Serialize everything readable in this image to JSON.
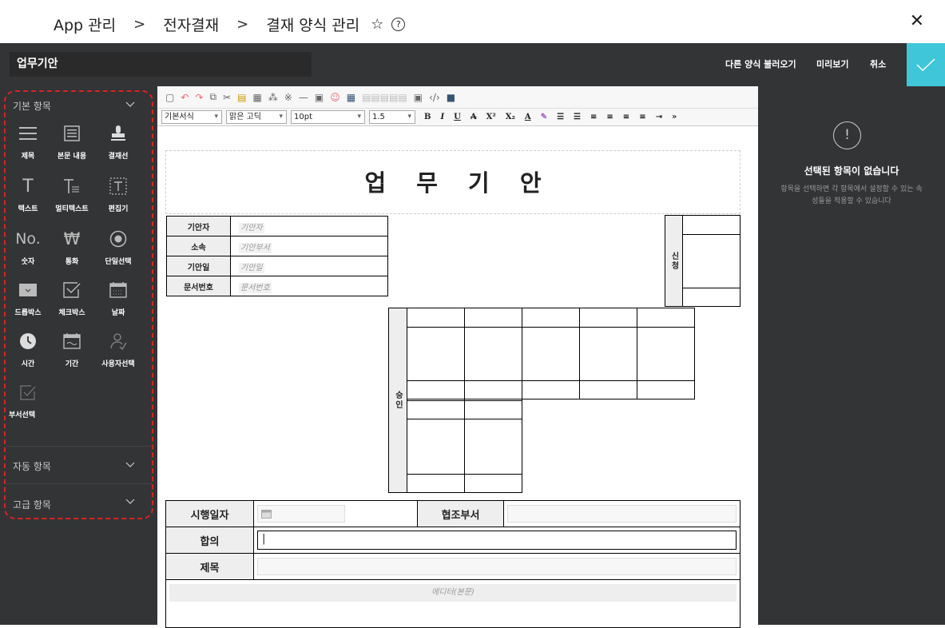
{
  "breadcrumb": {
    "items": [
      "App 관리",
      "전자결재",
      "결재 양식 관리"
    ],
    "separator": ">"
  },
  "header": {
    "doc_name": "업무기안",
    "load_other": "다른 양식 불러오기",
    "preview": "미리보기",
    "cancel": "취소"
  },
  "sidebar": {
    "basic_section": "기본 항목",
    "auto_section": "자동 항목",
    "advanced_section": "고급 항목",
    "tools": [
      "제목",
      "본문 내용",
      "결재선",
      "텍스트",
      "멀티텍스트",
      "편집기",
      "숫자",
      "통화",
      "단일선택",
      "드롭박스",
      "체크박스",
      "날짜",
      "시간",
      "기간",
      "사용자선택",
      "부서선택"
    ],
    "icon_glyphs": {
      "text": "T",
      "number": "No.",
      "currency": "₩"
    }
  },
  "toolbar": {
    "style": "기본서식",
    "font": "맑은 고딕",
    "size": "10pt",
    "line_height": "1.5"
  },
  "document": {
    "title": "업 무 기 안",
    "info_rows": [
      {
        "label": "기안자",
        "placeholder": "기안자"
      },
      {
        "label": "소속",
        "placeholder": "기안부서"
      },
      {
        "label": "기안일",
        "placeholder": "기안일"
      },
      {
        "label": "문서번호",
        "placeholder": "문서번호"
      }
    ],
    "apply_label": "신청",
    "approve_label": "승인",
    "bottom": {
      "effective_date": "시행일자",
      "coop_dept": "협조부서",
      "agreement": "합의",
      "subject": "제목",
      "body_placeholder": "에디터(본문)"
    }
  },
  "right_panel": {
    "title": "선택된 항목이 없습니다",
    "description": "항목을 선택하면 각 항목에서 설정할 수 있는 속성들을 적용할 수 있습니다",
    "icon_glyph": "!"
  },
  "colors": {
    "dark": "#333436",
    "accent": "#3fc6d8",
    "highlight": "#e02020"
  }
}
